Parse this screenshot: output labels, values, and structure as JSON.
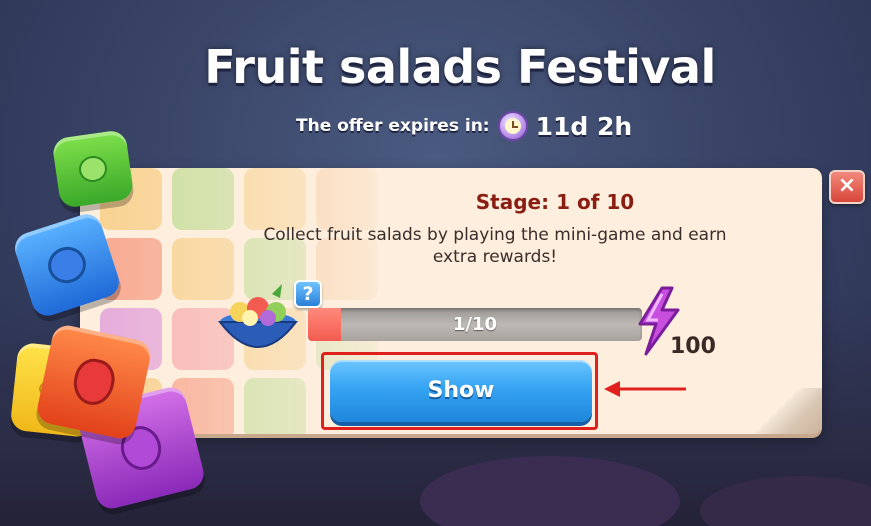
{
  "header": {
    "title": "Fruit salads Festival",
    "expires_label": "The offer expires in:",
    "expires_value": "11d 2h"
  },
  "panel": {
    "stage_label": "Stage: 1 of 10",
    "description": "Collect fruit salads by playing the mini-game and earn extra rewards!",
    "progress": {
      "text": "1/10",
      "current": 1,
      "total": 10
    },
    "help_badge": "?",
    "reward_amount": "100",
    "show_button_label": "Show",
    "close_symbol": "×"
  },
  "icons": {
    "clock": "clock-icon",
    "fruit_bowl": "fruit-salad-bowl-icon",
    "reward": "lightning-bolt-icon",
    "arrow": "left-arrow-icon"
  },
  "colors": {
    "title": "#ffffff",
    "stage_text": "#8a1e12",
    "progress_fill": "#f25b50",
    "button": "#36a3f2",
    "highlight": "#e0201c",
    "close": "#d8463a",
    "bolt": "#c84ee0"
  }
}
